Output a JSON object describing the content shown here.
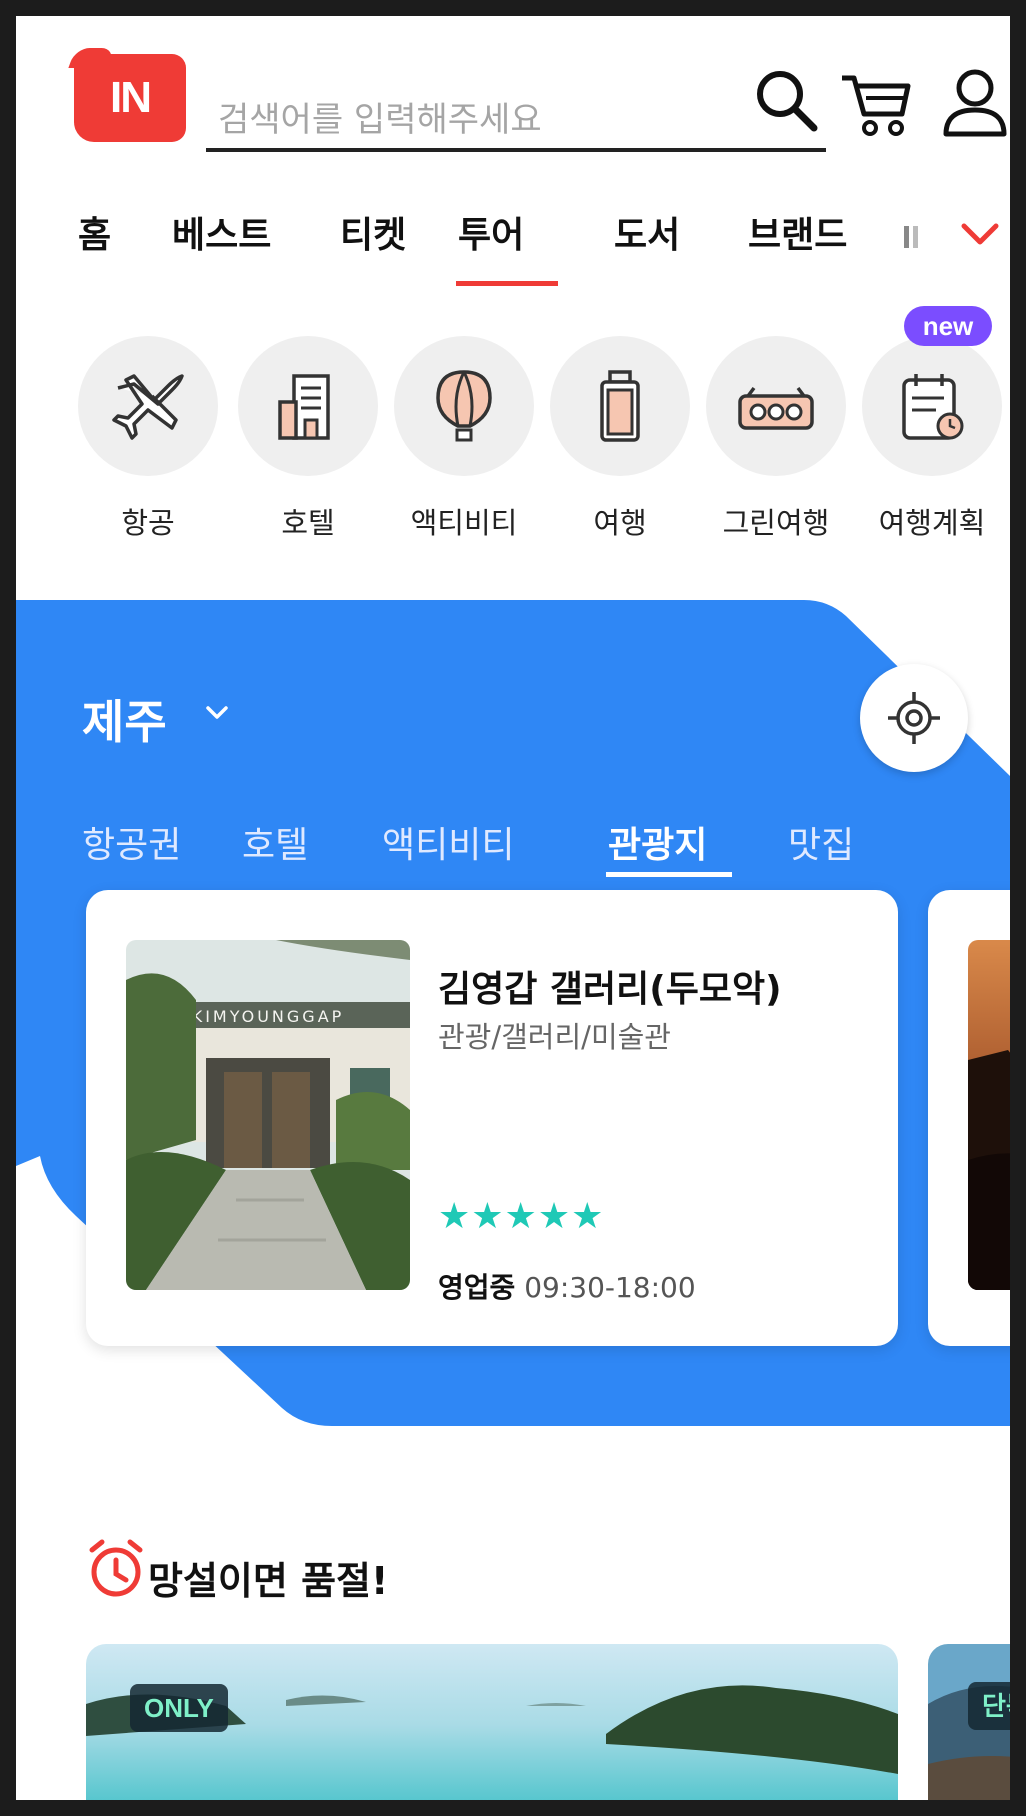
{
  "header": {
    "logo_text": "IN",
    "search_placeholder": "검색어를 입력해주세요"
  },
  "category_tabs": [
    "홈",
    "베스트",
    "티켓",
    "투어",
    "도서",
    "브랜드"
  ],
  "active_category": "투어",
  "services": [
    {
      "label": "항공",
      "icon": "airplane-icon"
    },
    {
      "label": "호텔",
      "icon": "hotel-icon"
    },
    {
      "label": "액티비티",
      "icon": "balloon-icon"
    },
    {
      "label": "여행",
      "icon": "luggage-icon"
    },
    {
      "label": "그린여행",
      "icon": "train-icon"
    },
    {
      "label": "여행계획",
      "icon": "calendar-icon",
      "badge": "new"
    }
  ],
  "region": {
    "name": "제주",
    "tabs": [
      "항공권",
      "호텔",
      "액티비티",
      "관광지",
      "맛집"
    ],
    "active_tab": "관광지"
  },
  "cards": [
    {
      "title": "김영갑 갤러리(두모악)",
      "category": "관광/갤러리/미술관",
      "rating": 5,
      "stars": "★★★★★",
      "status": "영업중",
      "hours": "09:30-18:00",
      "sign_text": "KIMYOUNGGAP"
    }
  ],
  "flash_sale": {
    "title": "망설이면 품절!",
    "items": [
      {
        "badge": "ONLY"
      },
      {
        "badge": "단독"
      }
    ]
  },
  "colors": {
    "brand_red": "#ef3b36",
    "blue": "#2f87f5",
    "star": "#1fc9b6",
    "new_badge": "#7b4dff"
  }
}
